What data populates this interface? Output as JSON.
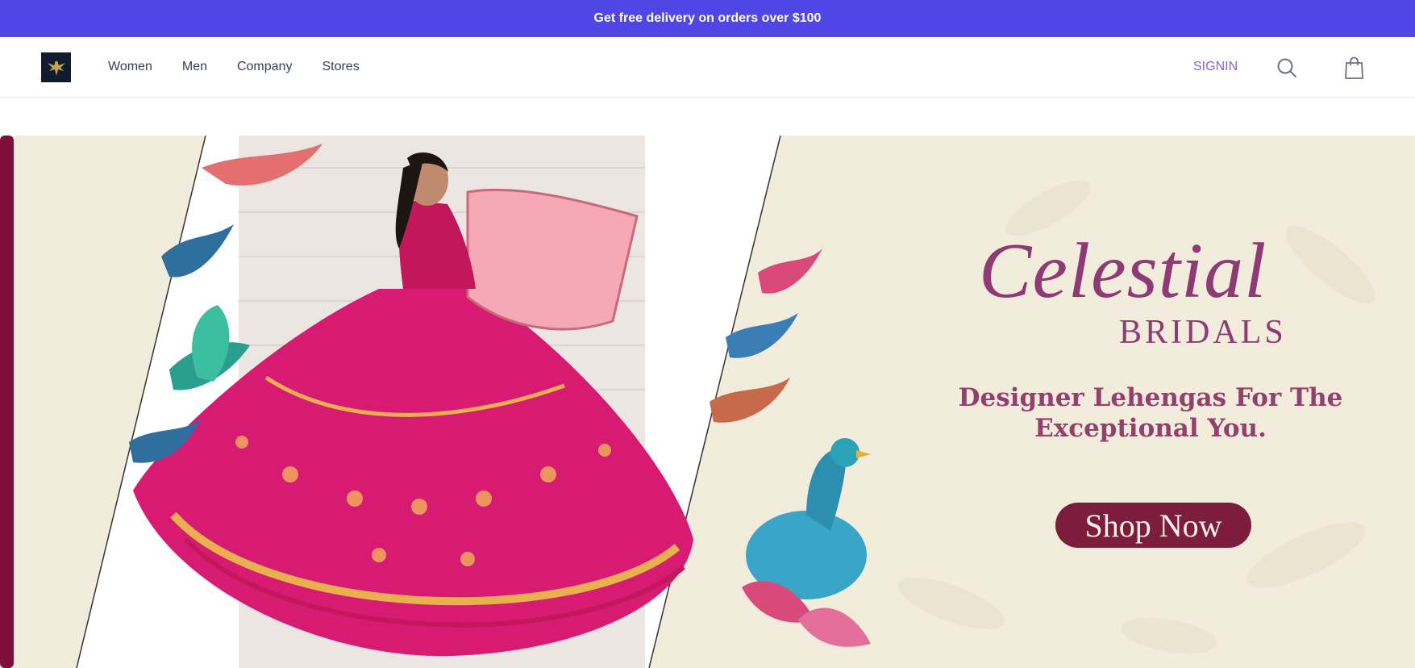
{
  "promo": {
    "text": "Get free delivery on orders over $100"
  },
  "nav": {
    "logo_icon": "eagle-logo-icon",
    "links": [
      {
        "label": "Women"
      },
      {
        "label": "Men"
      },
      {
        "label": "Company"
      },
      {
        "label": "Stores"
      }
    ],
    "signin_label": "SIGNIN",
    "search_icon": "search-icon",
    "cart_icon": "shopping-bag-icon"
  },
  "hero": {
    "brand_script": "Celestial",
    "brand_sub": "BRIDALS",
    "tagline": "Designer Lehengas For The Exceptional You.",
    "button_label": "Shop Now"
  },
  "colors": {
    "promo_bg": "#4f46e5",
    "signin": "#8b5cf6",
    "hero_bg": "#f2ecdc",
    "brand_text": "#8e3a74",
    "button_bg": "#7c1d3d"
  }
}
